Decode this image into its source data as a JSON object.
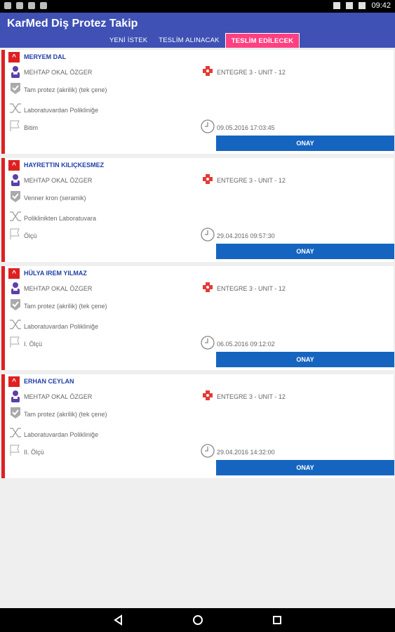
{
  "status_bar": {
    "time": "09:42"
  },
  "app": {
    "title": "KarMed Diş Protez Takip"
  },
  "tabs": [
    {
      "label": "YENİ İSTEK",
      "active": false
    },
    {
      "label": "TESLİM ALINACAK",
      "active": false
    },
    {
      "label": "TESLİM EDİLECEK",
      "active": true
    }
  ],
  "cards": [
    {
      "patient": "MERYEM DAL",
      "doctor": "MEHTAP OKAL ÖZGER",
      "clinic": "ENTEGRE 3 - UNIT - 12",
      "treatment": "Tam protez (akrilik) (tek çene)",
      "route": "Laboratuvardan Polikliniğe",
      "stage": "Bitim",
      "date": "09.05.2016 17:03:45",
      "button": "ONAY"
    },
    {
      "patient": "HAYRETTIN KILIÇKESMEZ",
      "doctor": "MEHTAP OKAL ÖZGER",
      "clinic": "ENTEGRE 3 - UNIT - 12",
      "treatment": "Venner kron  (seramik)",
      "route": "Poliklinikten Laboratuvara",
      "stage": "Ölçü",
      "date": "29.04.2016 09:57:30",
      "button": "ONAY"
    },
    {
      "patient": "HÜLYA IREM YILMAZ",
      "doctor": "MEHTAP OKAL ÖZGER",
      "clinic": "ENTEGRE 3 - UNIT - 12",
      "treatment": "Tam protez (akrilik) (tek çene)",
      "route": "Laboratuvardan Polikliniğe",
      "stage": "I. Ölçü",
      "date": "06.05.2016 09:12:02",
      "button": "ONAY"
    },
    {
      "patient": "ERHAN CEYLAN",
      "doctor": "MEHTAP OKAL ÖZGER",
      "clinic": "ENTEGRE 3 - UNIT - 12",
      "treatment": "Tam protez (akrilik) (tek çene)",
      "route": "Laboratuvardan Polikliniğe",
      "stage": "II. Ölçü",
      "date": "29.04.2016 14:32:00",
      "button": "ONAY"
    }
  ],
  "colors": {
    "primary": "#3f51b5",
    "accent": "#ff4081",
    "card_border": "#e02020",
    "button": "#1565c0",
    "patient_text": "#1f3fa8"
  }
}
